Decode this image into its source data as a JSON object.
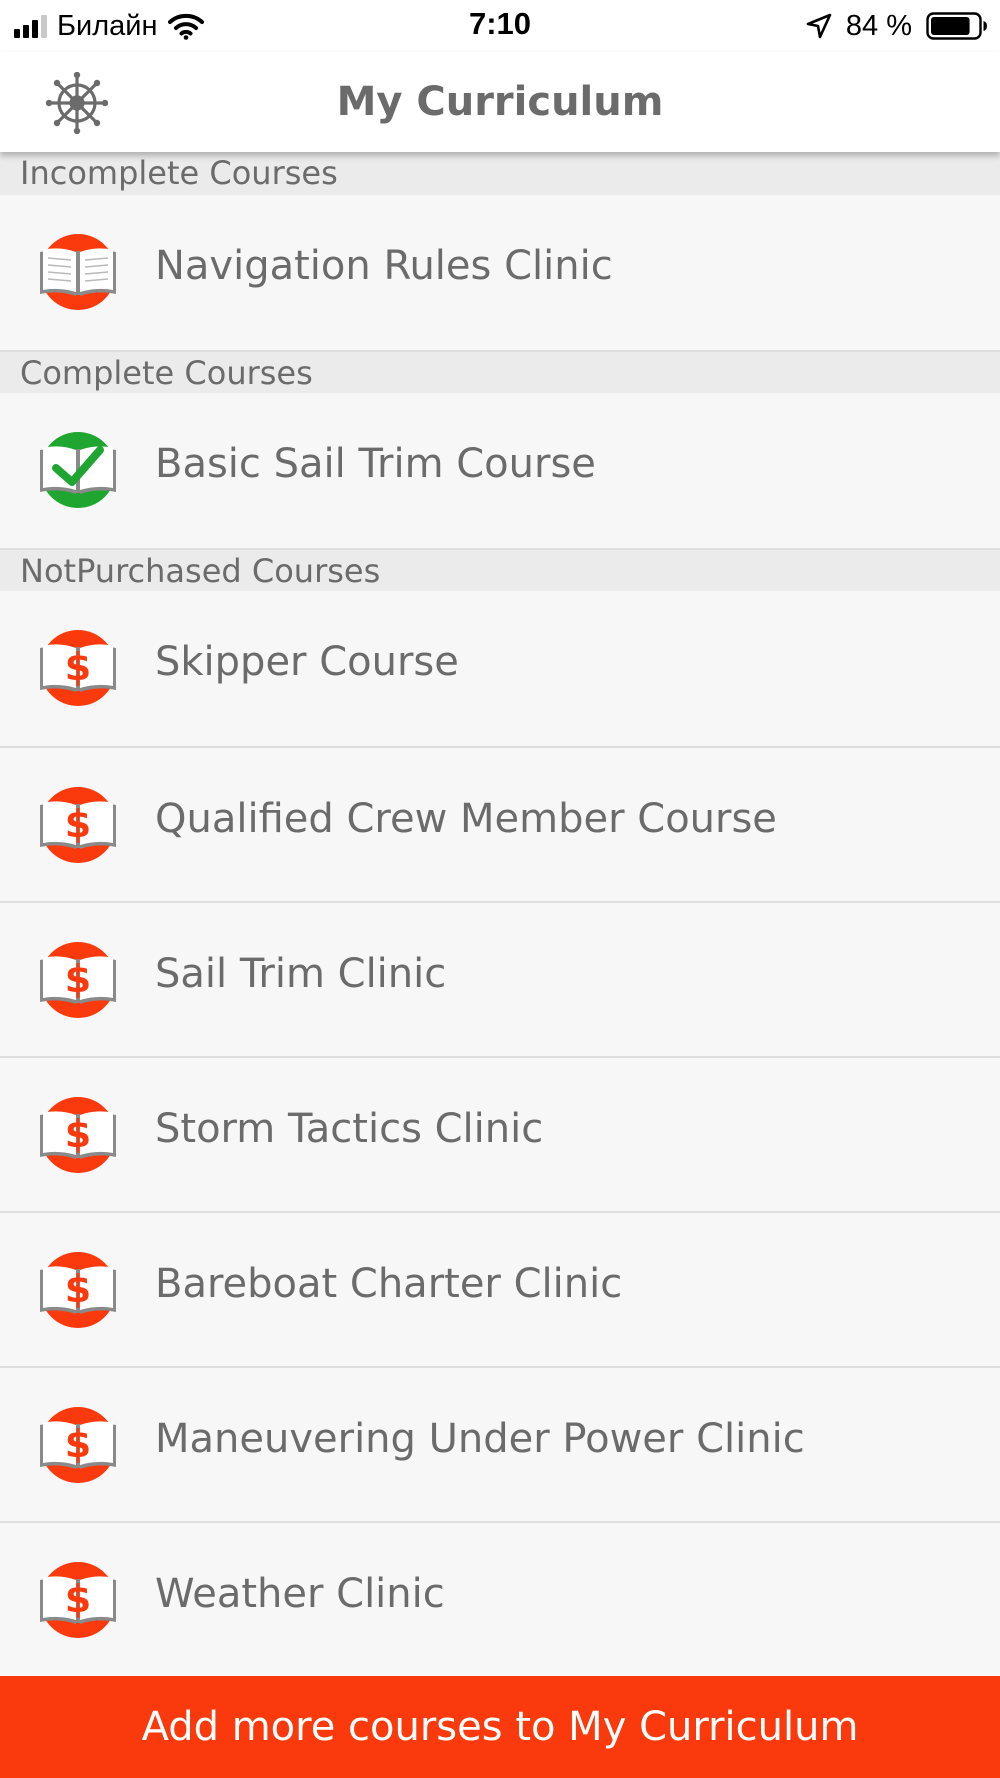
{
  "status_bar": {
    "carrier": "Билайн",
    "time": "7:10",
    "battery_percent": "84 %",
    "battery_level": 0.84
  },
  "header": {
    "title": "My Curriculum",
    "settings_icon": "ships-wheel-icon"
  },
  "sections": [
    {
      "title": "Incomplete Courses",
      "status": "incomplete",
      "courses": [
        "Navigation Rules Clinic"
      ]
    },
    {
      "title": "Complete Courses",
      "status": "complete",
      "courses": [
        "Basic Sail Trim Course"
      ]
    },
    {
      "title": "NotPurchased Courses",
      "status": "not-purchased",
      "courses": [
        "Skipper Course",
        "Qualified Crew Member Course",
        "Sail Trim Clinic",
        "Storm Tactics Clinic",
        "Bareboat Charter Clinic",
        "Maneuvering Under Power Clinic",
        "Weather Clinic"
      ]
    }
  ],
  "icons": {
    "incomplete": "open-book-icon",
    "complete": "book-checkmark-icon",
    "not-purchased": "book-dollar-icon"
  },
  "colors": {
    "accent": "#fa3a0d",
    "complete_green": "#1fa631",
    "text": "#6b6b6b"
  },
  "footer": {
    "cta_label": "Add more courses to My Curriculum"
  }
}
